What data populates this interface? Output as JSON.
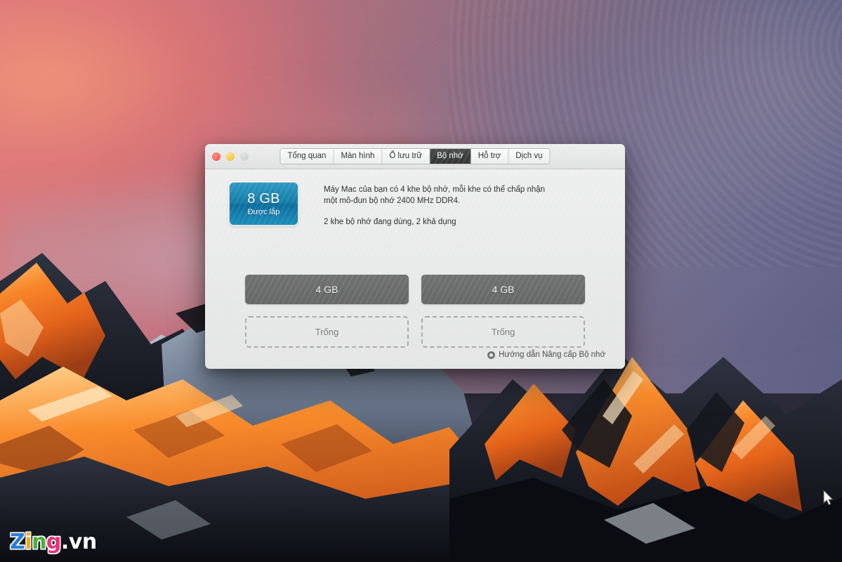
{
  "window": {
    "traffic_lights": [
      {
        "name": "close",
        "color": "#ef4b3c"
      },
      {
        "name": "minimize",
        "color": "#f0bc32"
      },
      {
        "name": "zoom",
        "color": "#c9c9c9"
      }
    ],
    "tabs": [
      {
        "label": "Tổng quan",
        "active": false
      },
      {
        "label": "Màn hình",
        "active": false
      },
      {
        "label": "Ổ lưu trữ",
        "active": false
      },
      {
        "label": "Bộ nhớ",
        "active": true
      },
      {
        "label": "Hỗ trợ",
        "active": false
      },
      {
        "label": "Dịch vụ",
        "active": false
      }
    ],
    "memory": {
      "badge": {
        "size": "8 GB",
        "label": "Được lắp",
        "color": "#157ba8"
      },
      "description_line1": "Máy Mac của bạn có 4 khe bộ nhớ, mỗi khe có thể chấp nhận",
      "description_line2": "một mô-đun bộ nhớ 2400 MHz DDR4.",
      "status": "2 khe bộ nhớ đang dùng, 2 khả dụng",
      "slots": [
        {
          "filled_label": "4 GB",
          "empty_label": "Trống"
        },
        {
          "filled_label": "4 GB",
          "empty_label": "Trống"
        }
      ]
    },
    "footer_link": {
      "icon": "help-circle-icon",
      "label": "Hướng dẫn Nâng cấp Bộ nhớ"
    }
  },
  "watermark": {
    "letters": [
      {
        "char": "Z",
        "color": "#2a7fd4"
      },
      {
        "char": "i",
        "color": "#f5a623"
      },
      {
        "char": "n",
        "color": "#4caf3f"
      },
      {
        "char": "g",
        "color": "#e8327c"
      }
    ],
    "suffix": ".vn"
  },
  "desktop": {
    "wallpaper_name": "macos-sierra-mountain"
  }
}
